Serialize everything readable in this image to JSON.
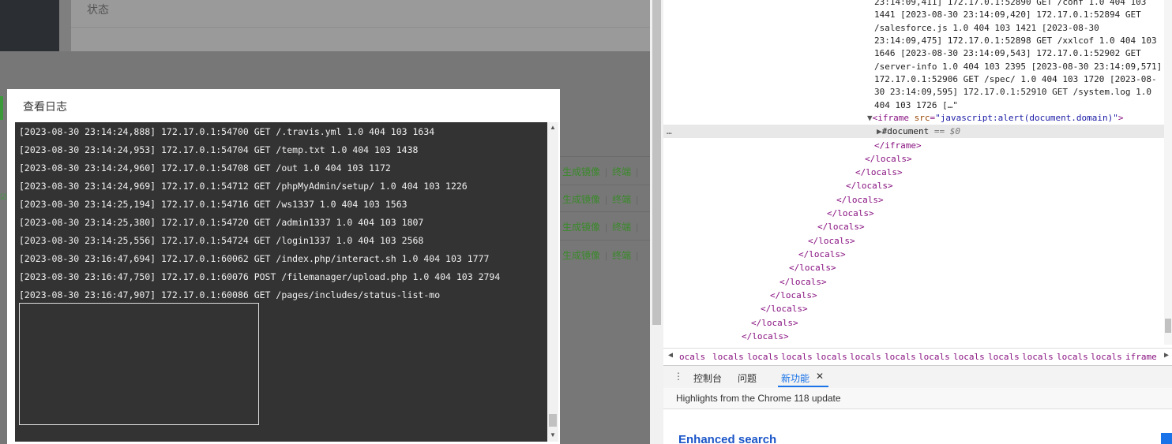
{
  "app": {
    "status_label": "状态",
    "row_actions": {
      "generate": "生成镜像",
      "terminal": "终端"
    }
  },
  "modal": {
    "title": "查看日志",
    "log_lines": [
      "[2023-08-30 23:14:24,888] 172.17.0.1:54700 GET /.travis.yml 1.0 404 103 1634",
      "[2023-08-30 23:14:24,953] 172.17.0.1:54704 GET /temp.txt 1.0 404 103 1438",
      "[2023-08-30 23:14:24,960] 172.17.0.1:54708 GET /out 1.0 404 103 1172",
      "[2023-08-30 23:14:24,969] 172.17.0.1:54712 GET /phpMyAdmin/setup/ 1.0 404 103 1226",
      "[2023-08-30 23:14:25,194] 172.17.0.1:54716 GET /ws1337 1.0 404 103 1563",
      "[2023-08-30 23:14:25,380] 172.17.0.1:54720 GET /admin1337 1.0 404 103 1807",
      "[2023-08-30 23:14:25,556] 172.17.0.1:54724 GET /login1337 1.0 404 103 2568",
      "[2023-08-30 23:16:47,694] 172.17.0.1:60062 GET /index.php/interact.sh 1.0 404 103 1777",
      "[2023-08-30 23:16:47,750] 172.17.0.1:60076 POST /filemanager/upload.php 1.0 404 103 2794",
      "[2023-08-30 23:16:47,907] 172.17.0.1:60086 GET /pages/includes/status-list-mo"
    ]
  },
  "devtools": {
    "text_lines": [
      "23:14:09,411] 172.17.0.1:52890 GET /conf 1.0 404 103",
      "1441 [2023-08-30 23:14:09,420] 172.17.0.1:52894 GET",
      "/salesforce.js 1.0 404 103 1421 [2023-08-30",
      "23:14:09,475] 172.17.0.1:52898 GET /xxlcof 1.0 404 103",
      "1646 [2023-08-30 23:14:09,543] 172.17.0.1:52902 GET",
      "/server-info 1.0 404 103 2395 [2023-08-30 23:14:09,571]",
      "172.17.0.1:52906 GET /spec/ 1.0 404 103 1720 [2023-08-",
      "30 23:14:09,595] 172.17.0.1:52910 GET /system.log 1.0",
      "404 103 1726 […\""
    ],
    "iframe_open_tag": "iframe",
    "iframe_attr_name": "src",
    "iframe_attr_value": "\"javascript:alert(document.domain)\"",
    "document_node": "#document",
    "document_eq": "== $0",
    "iframe_close": "</iframe>",
    "locals_close": "</locals>",
    "ellipsis": "…",
    "breadcrumbs": [
      "ocals",
      "locals",
      "locals",
      "locals",
      "locals",
      "locals",
      "locals",
      "locals",
      "locals",
      "locals",
      "locals",
      "locals",
      "locals",
      "iframe"
    ],
    "drawer_tabs": {
      "console": "控制台",
      "issues": "问题",
      "whats_new": "新功能"
    },
    "whats_new_text": "Highlights from the Chrome 118 update",
    "enhanced_heading": "Enhanced search"
  }
}
